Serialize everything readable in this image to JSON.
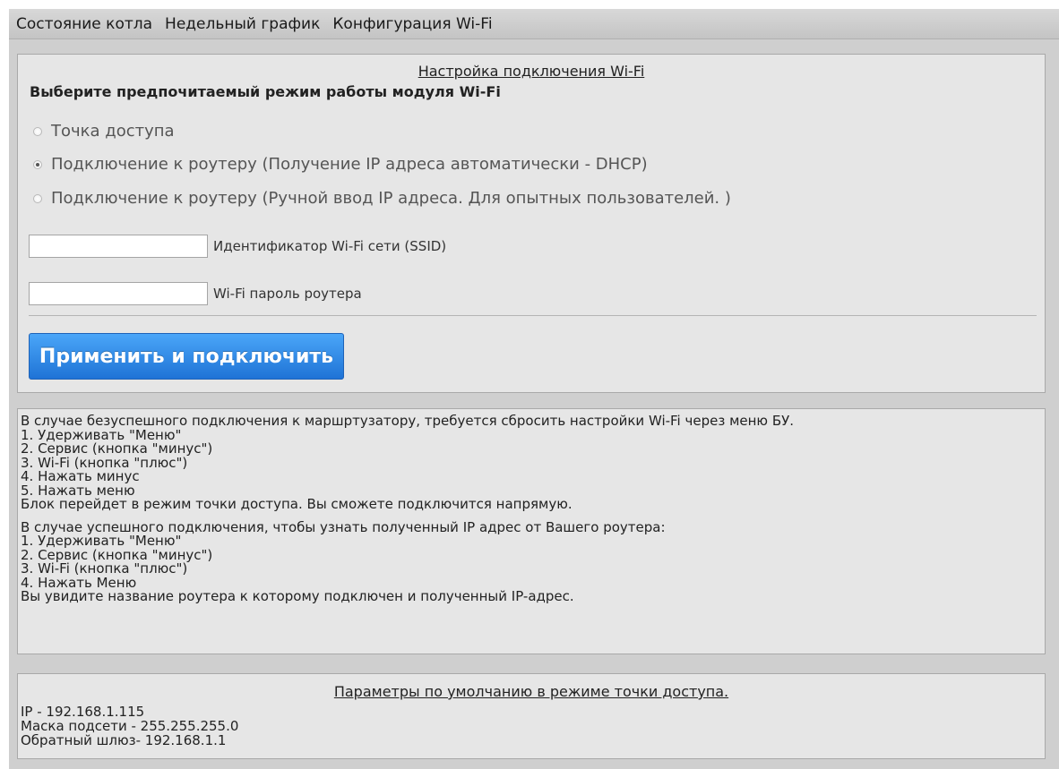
{
  "nav": {
    "items": [
      "Состояние котла",
      "Недельный график",
      "Конфигурация Wi-Fi"
    ]
  },
  "wifi": {
    "title": "Настройка подключения Wi-Fi",
    "mode_heading": "Выберите предпочитаемый режим работы модуля Wi-Fi",
    "modes": [
      {
        "label": "Точка доступа",
        "checked": false
      },
      {
        "label": "Подключение к роутеру (Получение IP адреса автоматически - DHCP)",
        "checked": true
      },
      {
        "label": "Подключение к роутеру (Ручной ввод IP адреса. Для опытных пользователей. )",
        "checked": false
      }
    ],
    "ssid": {
      "value": "",
      "label": "Идентификатор Wi-Fi сети (SSID)"
    },
    "password": {
      "value": "",
      "label": "Wi-Fi пароль роутера"
    },
    "apply_label": "Применить и подключить"
  },
  "info": {
    "fail_intro": "В случае безуспешного подключения к маршртузатору, требуется сбросить настройки Wi-Fi через меню БУ.",
    "fail_steps": [
      "1. Удерживать \"Меню\"",
      "2. Сервис (кнопка \"минус\")",
      "3. Wi-Fi (кнопка \"плюс\")",
      "4. Нажать минус",
      "5. Нажать меню"
    ],
    "fail_result": "Блок перейдет в режим точки доступа. Вы сможете подключится напрямую.",
    "success_intro": "В случае успешного подключения, чтобы узнать полученный IP адрес от Вашего роутера:",
    "success_steps": [
      "1. Удерживать \"Меню\"",
      "2. Сервис (кнопка \"минус\")",
      "3. Wi-Fi (кнопка \"плюс\")",
      "4. Нажать Меню"
    ],
    "success_result": "Вы увидите название роутера к которому подключен и полученный IP-адрес."
  },
  "defaults": {
    "title": "Параметры по умолчанию в режиме точки доступа.",
    "ip": "IP - 192.168.1.115",
    "mask": "Маска подсети - 255.255.255.0",
    "gateway": "Обратный шлюз- 192.168.1.1"
  }
}
